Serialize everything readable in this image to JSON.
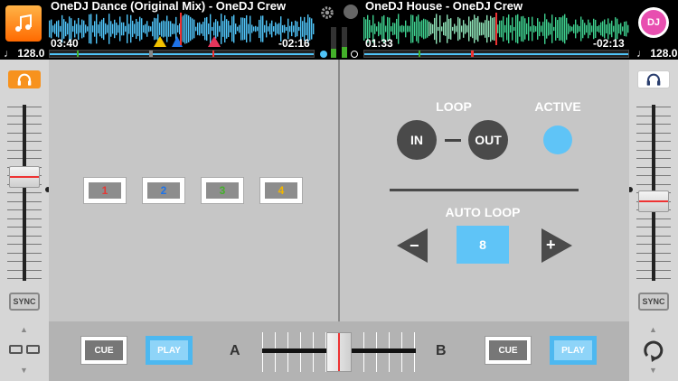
{
  "deckA": {
    "title": "OneDJ Dance (Original Mix) - OneDJ Crew",
    "elapsed": "03:40",
    "remaining": "-02:16",
    "bpm": "128.0"
  },
  "deckB": {
    "title": "OneDJ House - OneDJ Crew",
    "elapsed": "01:33",
    "remaining": "-02:13",
    "bpm": "128.0"
  },
  "logo_text": "DJ",
  "sync_label": "SYNC",
  "hotcues": [
    {
      "label": "1",
      "color": "#e53935"
    },
    {
      "label": "2",
      "color": "#1e73e8"
    },
    {
      "label": "3",
      "color": "#43b02a"
    },
    {
      "label": "4",
      "color": "#f2b600"
    }
  ],
  "loop": {
    "title": "LOOP",
    "in_label": "IN",
    "out_label": "OUT",
    "active_label": "ACTIVE",
    "auto_loop_title": "AUTO LOOP",
    "auto_loop_value": "8",
    "minus_label": "−",
    "plus_label": "+"
  },
  "transport": {
    "cue_label": "CUE",
    "play_label": "PLAY",
    "a_label": "A",
    "b_label": "B"
  },
  "colors": {
    "accent_blue": "#5fc4f7",
    "headphone_active": "#f7921e",
    "wave_a": "#4fc3f7",
    "wave_b": "#3ecf8e"
  }
}
